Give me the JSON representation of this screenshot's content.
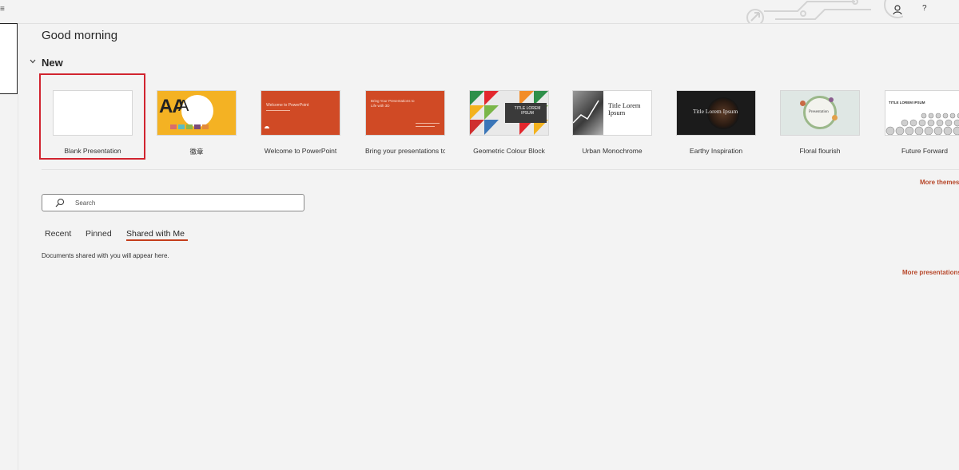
{
  "titlebar": {
    "help_label": "?",
    "left_glyph": "≡"
  },
  "greeting": "Good morning",
  "new_section": {
    "label": "New",
    "templates": [
      {
        "name": "Blank Presentation"
      },
      {
        "name": "徽章",
        "thumb_text": "AA"
      },
      {
        "name": "Welcome to PowerPoint",
        "thumb_text": "Welcome to PowerPoint"
      },
      {
        "name": "Bring your presentations to li...",
        "thumb_text": "Bring Your Presentations to Life with 3D"
      },
      {
        "name": "Geometric Colour Block",
        "thumb_text": "TITLE LOREM IPSUM"
      },
      {
        "name": "Urban Monochrome",
        "thumb_text": "Title Lorem Ipsum"
      },
      {
        "name": "Earthy Inspiration",
        "thumb_text": "Title Lorem Ipsum"
      },
      {
        "name": "Floral flourish",
        "thumb_text": "Presentation"
      },
      {
        "name": "Future Forward",
        "thumb_text": "TITLE LOREM IPSUM"
      }
    ],
    "more_themes": "More themes"
  },
  "search": {
    "placeholder": "Search"
  },
  "tabs": [
    {
      "label": "Recent"
    },
    {
      "label": "Pinned"
    },
    {
      "label": "Shared with Me",
      "active": true
    }
  ],
  "empty_message": "Documents shared with you will appear here.",
  "more_presentations": "More presentations",
  "colors": {
    "accent": "#c43e1c",
    "selection": "#d1242f",
    "link": "#b7472a"
  }
}
